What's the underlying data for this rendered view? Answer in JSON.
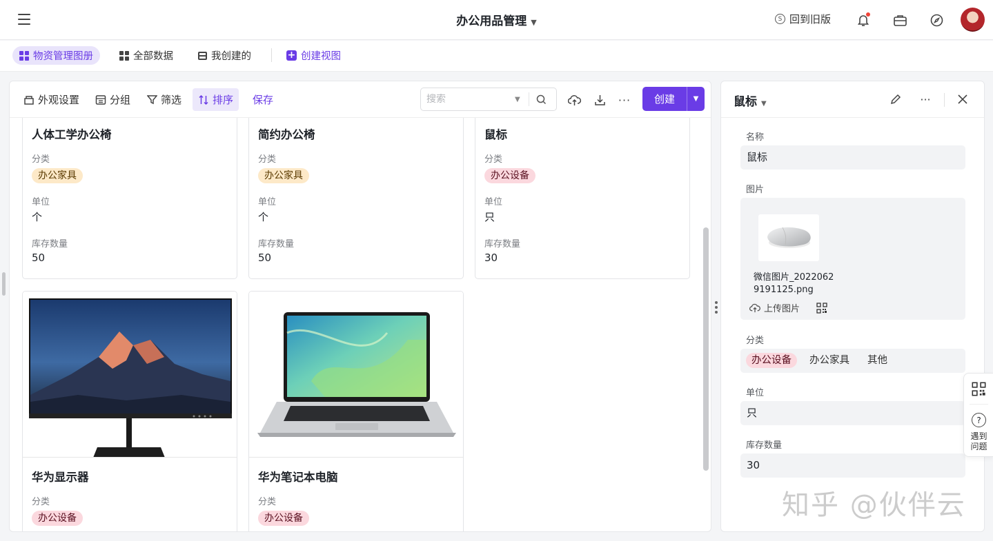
{
  "header": {
    "title": "办公用品管理",
    "old_version": "回到旧版"
  },
  "views": {
    "items": [
      "物资管理图册",
      "全部数据",
      "我创建的"
    ],
    "create_view": "创建视图"
  },
  "toolbar": {
    "appearance": "外观设置",
    "group": "分组",
    "filter": "筛选",
    "sort": "排序",
    "save": "保存",
    "search_placeholder": "搜索",
    "create": "创建"
  },
  "cards": [
    {
      "title": "人体工学办公椅",
      "category_label": "分类",
      "category": "办公家具",
      "unit_label": "单位",
      "unit": "个",
      "stock_label": "库存数量",
      "stock": "50"
    },
    {
      "title": "简约办公椅",
      "category_label": "分类",
      "category": "办公家具",
      "unit_label": "单位",
      "unit": "个",
      "stock_label": "库存数量",
      "stock": "50"
    },
    {
      "title": "鼠标",
      "category_label": "分类",
      "category": "办公设备",
      "unit_label": "单位",
      "unit": "只",
      "stock_label": "库存数量",
      "stock": "30"
    },
    {
      "title": "华为显示器",
      "category_label": "分类",
      "category": "办公设备"
    },
    {
      "title": "华为笔记本电脑",
      "category_label": "分类",
      "category": "办公设备"
    }
  ],
  "detail": {
    "title": "鼠标",
    "name_label": "名称",
    "name": "鼠标",
    "image_label": "图片",
    "file_name": "微信图片_20220629191125.png",
    "upload": "上传图片",
    "category_label": "分类",
    "category_options": [
      "办公设备",
      "办公家具",
      "其他"
    ],
    "unit_label": "单位",
    "unit": "只",
    "stock_label": "库存数量",
    "stock": "30"
  },
  "float_widget": {
    "help": "遇到问题"
  },
  "watermark": "知乎 @伙伴云",
  "colors": {
    "accent": "#6a3ce6",
    "tag_furniture": "#fde9c8",
    "tag_device": "#fbd8de"
  }
}
